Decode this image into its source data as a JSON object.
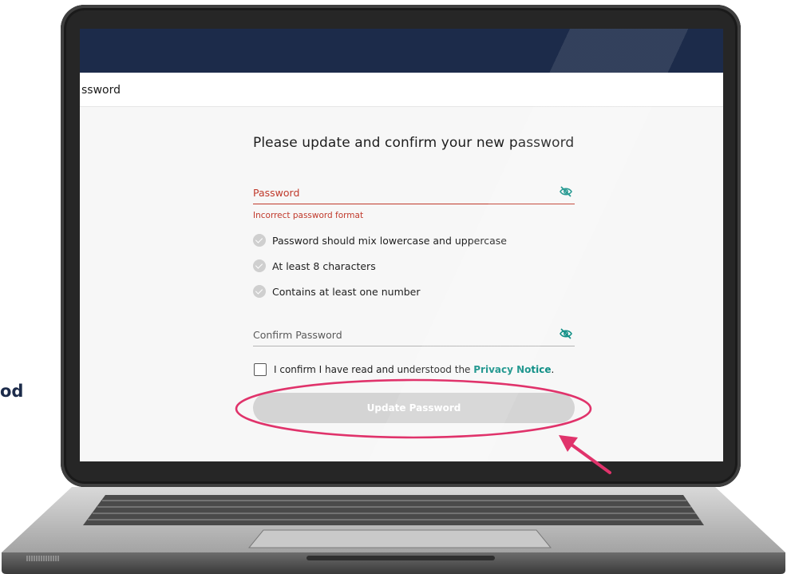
{
  "page": {
    "heading": "ssword",
    "side_text": "od"
  },
  "form": {
    "title": "Please update and confirm your new password",
    "password": {
      "label": "Password",
      "error": "Incorrect password format",
      "toggle_icon": "eye-off-icon"
    },
    "rules": [
      {
        "text": "Password should mix lowercase and uppercase",
        "icon": "check-circle-icon"
      },
      {
        "text": "At least 8 characters",
        "icon": "check-circle-icon"
      },
      {
        "text": "Contains at least one number",
        "icon": "check-circle-icon"
      }
    ],
    "confirm_password": {
      "label": "Confirm Password",
      "toggle_icon": "eye-off-icon"
    },
    "consent": {
      "text": "I confirm I have read and understood the ",
      "link": "Privacy Notice",
      "suffix": "."
    },
    "submit_label": "Update Password"
  },
  "colors": {
    "header": "#1c2b4a",
    "error": "#c0392b",
    "accent": "#0f8f86",
    "button_disabled": "#d4d4d4",
    "annotation": "#e0336b"
  }
}
